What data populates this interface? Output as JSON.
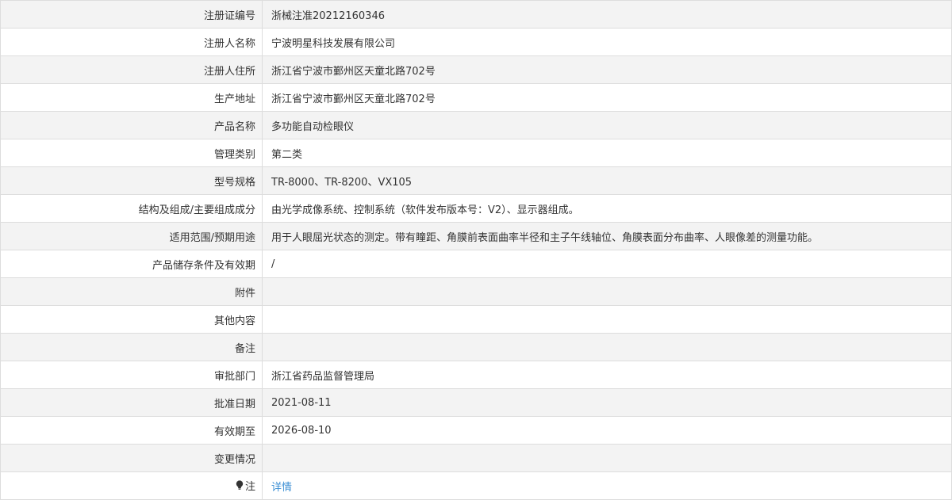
{
  "rows": [
    {
      "label": "注册证编号",
      "value": "浙械注准20212160346"
    },
    {
      "label": "注册人名称",
      "value": "宁波明星科技发展有限公司"
    },
    {
      "label": "注册人住所",
      "value": "浙江省宁波市鄞州区天童北路702号"
    },
    {
      "label": "生产地址",
      "value": "浙江省宁波市鄞州区天童北路702号"
    },
    {
      "label": "产品名称",
      "value": "多功能自动检眼仪"
    },
    {
      "label": "管理类别",
      "value": "第二类"
    },
    {
      "label": "型号规格",
      "value": "TR-8000、TR-8200、VX105"
    },
    {
      "label": "结构及组成/主要组成成分",
      "value": "由光学成像系统、控制系统（软件发布版本号：V2）、显示器组成。"
    },
    {
      "label": "适用范围/预期用途",
      "value": "用于人眼屈光状态的测定。带有瞳距、角膜前表面曲率半径和主子午线轴位、角膜表面分布曲率、人眼像差的测量功能。"
    },
    {
      "label": "产品储存条件及有效期",
      "value": "/"
    },
    {
      "label": "附件",
      "value": ""
    },
    {
      "label": "其他内容",
      "value": ""
    },
    {
      "label": "备注",
      "value": ""
    },
    {
      "label": "审批部门",
      "value": "浙江省药品监督管理局"
    },
    {
      "label": "批准日期",
      "value": "2021-08-11"
    },
    {
      "label": "有效期至",
      "value": "2026-08-10"
    },
    {
      "label": "变更情况",
      "value": ""
    }
  ],
  "note": {
    "label": "注",
    "icon": "lightbulb-icon",
    "link_text": "详情",
    "link_color": "#3c8fd4"
  }
}
